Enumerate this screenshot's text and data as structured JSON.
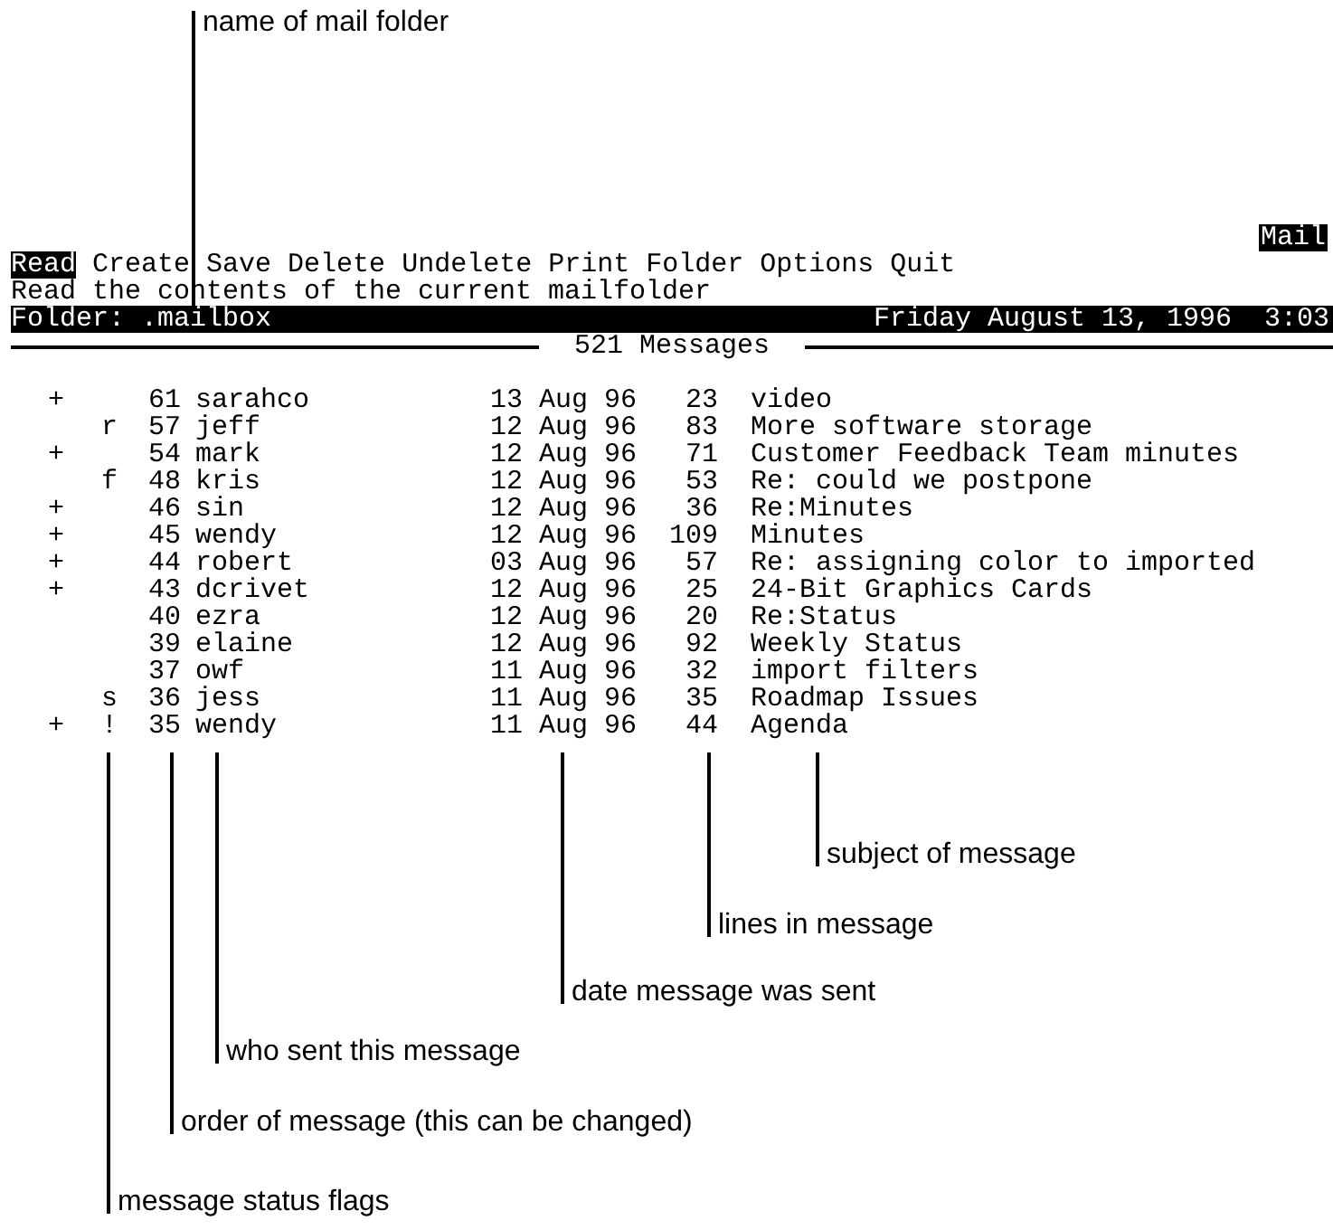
{
  "callouts_top": [
    {
      "label": "name of mail folder"
    }
  ],
  "app_title": "Mail",
  "menu": [
    {
      "label": "Read",
      "selected": true
    },
    {
      "label": "Create",
      "selected": false
    },
    {
      "label": "Save",
      "selected": false
    },
    {
      "label": "Delete",
      "selected": false
    },
    {
      "label": "Undelete",
      "selected": false
    },
    {
      "label": "Print",
      "selected": false
    },
    {
      "label": "Folder",
      "selected": false
    },
    {
      "label": "Options",
      "selected": false
    },
    {
      "label": "Quit",
      "selected": false
    }
  ],
  "hint": "Read the contents of the current mailfolder",
  "folder_bar": {
    "label": "Folder:",
    "folder": ".mailbox",
    "date": "Friday August 13, 1996",
    "time": "3:03"
  },
  "message_count": "521 Messages",
  "messages": [
    {
      "flag_1": "+",
      "number": "61",
      "sender": "sarahco",
      "date": "13 Aug 96",
      "lines": "23",
      "subject": "video"
    },
    {
      "flag_2": "r",
      "number": "57",
      "sender": "jeff",
      "date": "12 Aug 96",
      "lines": "83",
      "subject": "More software storage"
    },
    {
      "flag_1": "+",
      "number": "54",
      "sender": "mark",
      "date": "12 Aug 96",
      "lines": "71",
      "subject": "Customer Feedback Team minutes"
    },
    {
      "flag_2": "f",
      "number": "48",
      "sender": "kris",
      "date": "12 Aug 96",
      "lines": "53",
      "subject": "Re: could we postpone"
    },
    {
      "flag_1": "+",
      "number": "46",
      "sender": "sin",
      "date": "12 Aug 96",
      "lines": "36",
      "subject": "Re:Minutes"
    },
    {
      "flag_1": "+",
      "number": "45",
      "sender": "wendy",
      "date": "12 Aug 96",
      "lines": "109",
      "subject": "Minutes"
    },
    {
      "flag_1": "+",
      "number": "44",
      "sender": "robert",
      "date": "03 Aug 96",
      "lines": "57",
      "subject": "Re: assigning color to imported"
    },
    {
      "flag_1": "+",
      "number": "43",
      "sender": "dcrivet",
      "date": "12 Aug 96",
      "lines": "25",
      "subject": "24-Bit Graphics Cards"
    },
    {
      "number": "40",
      "sender": "ezra",
      "date": "12 Aug 96",
      "lines": "20",
      "subject": "Re:Status"
    },
    {
      "number": "39",
      "sender": "elaine",
      "date": "12 Aug 96",
      "lines": "92",
      "subject": "Weekly Status"
    },
    {
      "number": "37",
      "sender": "owf",
      "date": "11 Aug 96",
      "lines": "32",
      "subject": "import filters"
    },
    {
      "flag_2": "s",
      "number": "36",
      "sender": "jess",
      "date": "11 Aug 96",
      "lines": "35",
      "subject": "Roadmap Issues"
    },
    {
      "flag_1": "+",
      "flag_2": "!",
      "number": "35",
      "sender": "wendy",
      "date": "11 Aug 96",
      "lines": "44",
      "subject": "Agenda"
    }
  ],
  "callouts_bottom": [
    {
      "label": "subject of message"
    },
    {
      "label": "lines in message"
    },
    {
      "label": "date message was sent"
    },
    {
      "label": "who sent this message"
    },
    {
      "label": "order of message (this can be changed)"
    },
    {
      "label": "message status flags"
    }
  ]
}
